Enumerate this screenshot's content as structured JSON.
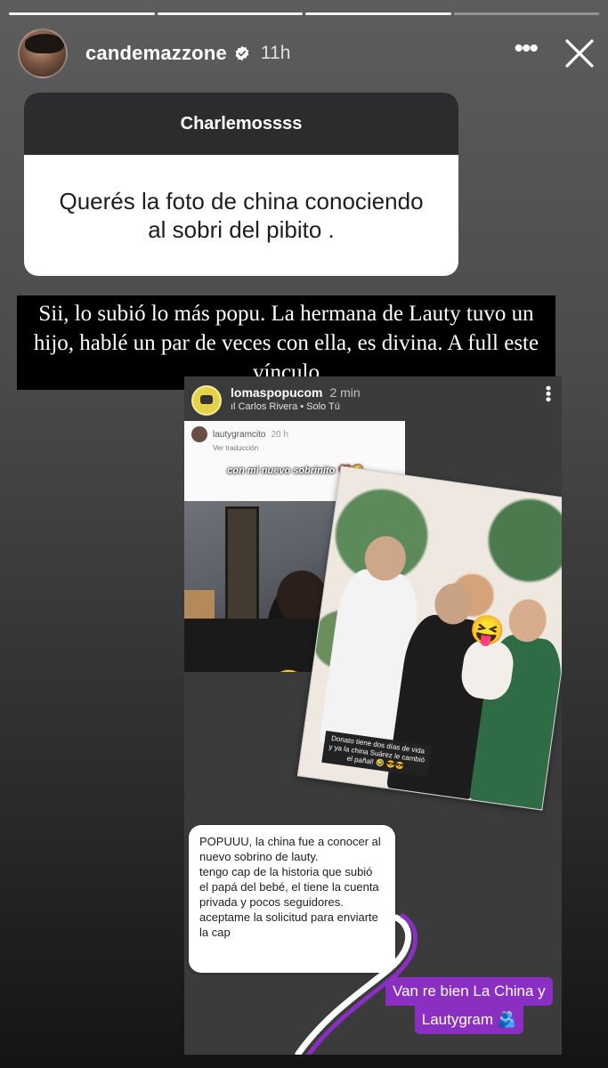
{
  "story": {
    "username": "candemazzone",
    "time_ago": "11h",
    "progress_segments": 4,
    "progress_done": 3
  },
  "question": {
    "title": "Charlemossss",
    "text": "Querés la foto de china conociendo al sobri del pibito ."
  },
  "caption": "Sii, lo subió lo más popu. La hermana de Lauty tuvo un hijo, hablé un par de veces con ella, es divina. A full este vínculo",
  "shared_post": {
    "username": "lomaspopucom",
    "time_ago": "2 min",
    "music": "ıl Carlos Rivera • Solo Tú",
    "inner_story": {
      "username": "lautygramcito",
      "time_ago": "20 h",
      "translate": "Ver traducción",
      "label": "con mi nuevo sobrinito ❤️🥺",
      "emoji": "😝"
    },
    "group_photo": {
      "caption": "Donato tiene dos días de vida y ya la china Suárez le cambió el pañal! 🤣 😎😎",
      "emoji": "😝"
    },
    "dm_message": "POPUUU, la china fue a conocer al nuevo sobrino de lauty.\ntengo cap de la historia que subió el papá del bebé, el tiene la cuenta privada y pocos seguidores.\naceptame la solicitud para enviarte la cap",
    "sticker": {
      "line1": "Van re bien La China y",
      "line2": "Lautygram 🫂"
    }
  },
  "colors": {
    "sticker_purple": "#8b2fc3",
    "question_header": "#2c2c2e",
    "verified_blue": "#ffffff"
  },
  "icons": [
    "verified-icon",
    "more-icon",
    "close-icon"
  ]
}
